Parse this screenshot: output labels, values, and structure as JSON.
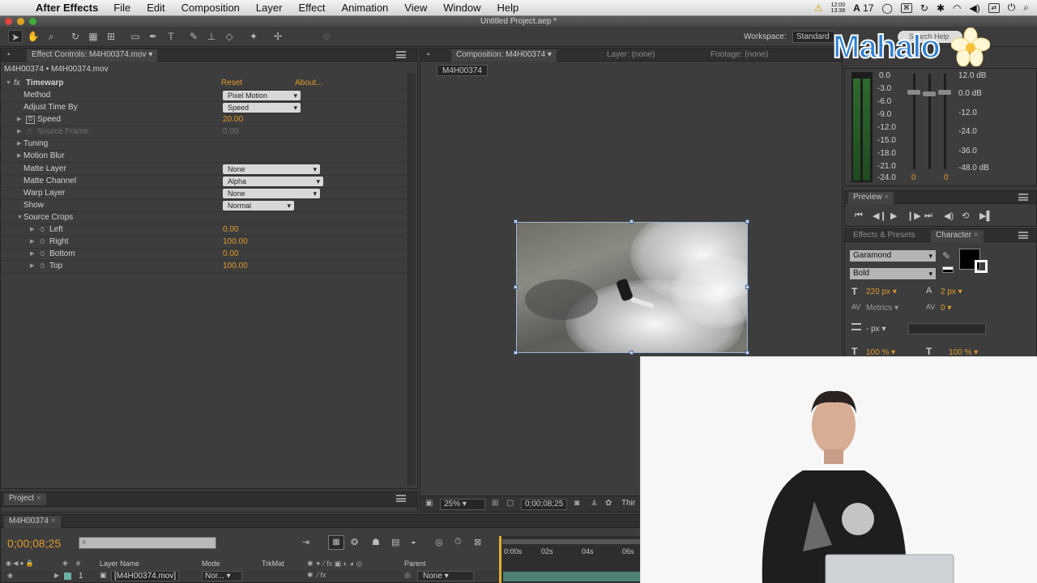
{
  "menubar": {
    "app_name": "After Effects",
    "menus": [
      "File",
      "Edit",
      "Composition",
      "Layer",
      "Effect",
      "Animation",
      "View",
      "Window",
      "Help"
    ],
    "clock_top": "12:00",
    "clock_bottom": "13:38",
    "status_num": "17"
  },
  "window": {
    "title": "Untitled Project.aep *"
  },
  "toolbar": {
    "workspace_label": "Workspace:",
    "workspace_value": "Standard",
    "search_placeholder": "Search Help"
  },
  "effect_controls": {
    "tab": "Effect Controls: M4H00374.mov",
    "subtitle": "M4H00374 • M4H00374.mov",
    "effect_name": "Timewarp",
    "reset": "Reset",
    "about": "About...",
    "rows": {
      "method": {
        "label": "Method",
        "value": "Pixel Motion"
      },
      "adjust": {
        "label": "Adjust Time By",
        "value": "Speed"
      },
      "speed": {
        "label": "Speed",
        "value": "20.00"
      },
      "source_frame": {
        "label": "Source Frame",
        "value": "0.00"
      },
      "tuning": {
        "label": "Tuning"
      },
      "motion_blur": {
        "label": "Motion Blur"
      },
      "matte_layer": {
        "label": "Matte Layer",
        "value": "None"
      },
      "matte_channel": {
        "label": "Matte Channel",
        "value": "Alpha"
      },
      "warp_layer": {
        "label": "Warp Layer",
        "value": "None"
      },
      "show": {
        "label": "Show",
        "value": "Normal"
      },
      "source_crops": {
        "label": "Source Crops"
      },
      "left": {
        "label": "Left",
        "value": "0.00"
      },
      "right": {
        "label": "Right",
        "value": "100.00"
      },
      "bottom": {
        "label": "Bottom",
        "value": "0.00"
      },
      "top": {
        "label": "Top",
        "value": "100.00"
      }
    }
  },
  "composition": {
    "tab": "Composition: M4H00374",
    "layer_tab": "Layer: (none)",
    "footage_tab": "Footage: (none)",
    "chip": "M4H00374",
    "zoom": "25%",
    "timecode": "0;00;08;25",
    "view": "Thir"
  },
  "audio": {
    "left_scale": [
      "0.0",
      "-3.0",
      "-6.0",
      "-9.0",
      "-12.0",
      "-15.0",
      "-18.0",
      "-21.0",
      "-24.0"
    ],
    "right_scale": [
      "12.0 dB",
      "0.0 dB",
      "-12.0",
      "-24.0",
      "-36.0",
      "-48.0 dB"
    ],
    "channel_left": "0",
    "channel_right": "0"
  },
  "preview": {
    "tab": "Preview"
  },
  "character": {
    "tab_effects": "Effects & Presets",
    "tab": "Character",
    "font": "Garamond",
    "style": "Bold",
    "size": "220 px",
    "leading": "2 px",
    "kerning": "Metrics",
    "tracking": "0",
    "stroke": "- px",
    "vscale": "100 %",
    "hscale": "100 %"
  },
  "project": {
    "tab": "Project"
  },
  "timeline": {
    "tab": "M4H00374",
    "timecode": "0;00;08;25",
    "columns": {
      "layer_name": "Layer Name",
      "mode": "Mode",
      "trkmat": "TrkMat",
      "parent": "Parent"
    },
    "ruler": [
      "0:00s",
      "02s",
      "04s",
      "06s"
    ],
    "layer": {
      "index": "1",
      "name": "[M4H00374.mov]",
      "mode": "Nor...",
      "parent": "None"
    }
  },
  "watermark": {
    "text": "Mahalo"
  },
  "colors": {
    "accent_orange": "#e09a2e",
    "panel_bg": "#3d3d3d",
    "brand_blue": "#2c7fd6"
  }
}
